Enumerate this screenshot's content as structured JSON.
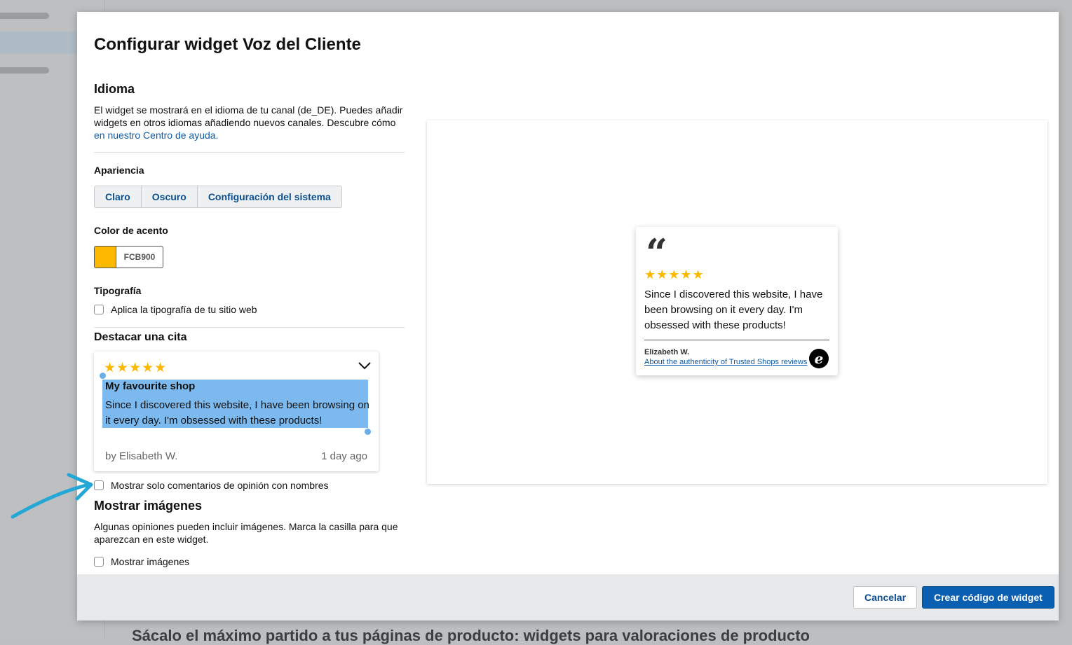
{
  "background": {
    "heading": "Sácalo el máximo partido a tus páginas de producto: widgets para valoraciones de producto"
  },
  "modal": {
    "title": "Configurar widget Voz del Cliente",
    "idioma": {
      "heading": "Idioma",
      "text": "El widget se mostrará en el idioma de tu canal (de_DE). Puedes añadir widgets en otros idiomas añadiendo nuevos canales. Descubre cómo",
      "link": "en nuestro Centro de ayuda."
    },
    "apariencia": {
      "heading": "Apariencia",
      "options": [
        "Claro",
        "Oscuro",
        "Configuración del sistema"
      ]
    },
    "accent": {
      "heading": "Color de acento",
      "hex": "FCB900",
      "color": "#FCB900"
    },
    "tipografia": {
      "heading": "Tipografía",
      "checkbox_label": "Aplica la tipografía de tu sitio web"
    },
    "cita": {
      "heading": "Destacar una cita",
      "stars": "★★★★★",
      "title": "My favourite shop",
      "body": "Since I discovered this website, I have been browsing on it every day. I'm obsessed with these products!",
      "author": "by Elisabeth W.",
      "time": "1 day ago",
      "checkbox_label": "Mostrar solo comentarios de opinión con nombres"
    },
    "imagenes": {
      "heading": "Mostrar imágenes",
      "text": "Algunas opiniones pueden incluir imágenes. Marca la casilla para que aparezcan en este widget.",
      "checkbox_label": "Mostrar imágenes"
    },
    "preview": {
      "quote_mark": "“",
      "stars": "★★★★★",
      "text": "Since I discovered this website, I have been browsing on it every day. I'm obsessed with these products!",
      "name": "Elizabeth W.",
      "authenticity_link": "About the authenticity of Trusted Shops reviews",
      "logo_letter": "e"
    },
    "footer": {
      "cancel": "Cancelar",
      "create": "Crear código de widget"
    }
  }
}
